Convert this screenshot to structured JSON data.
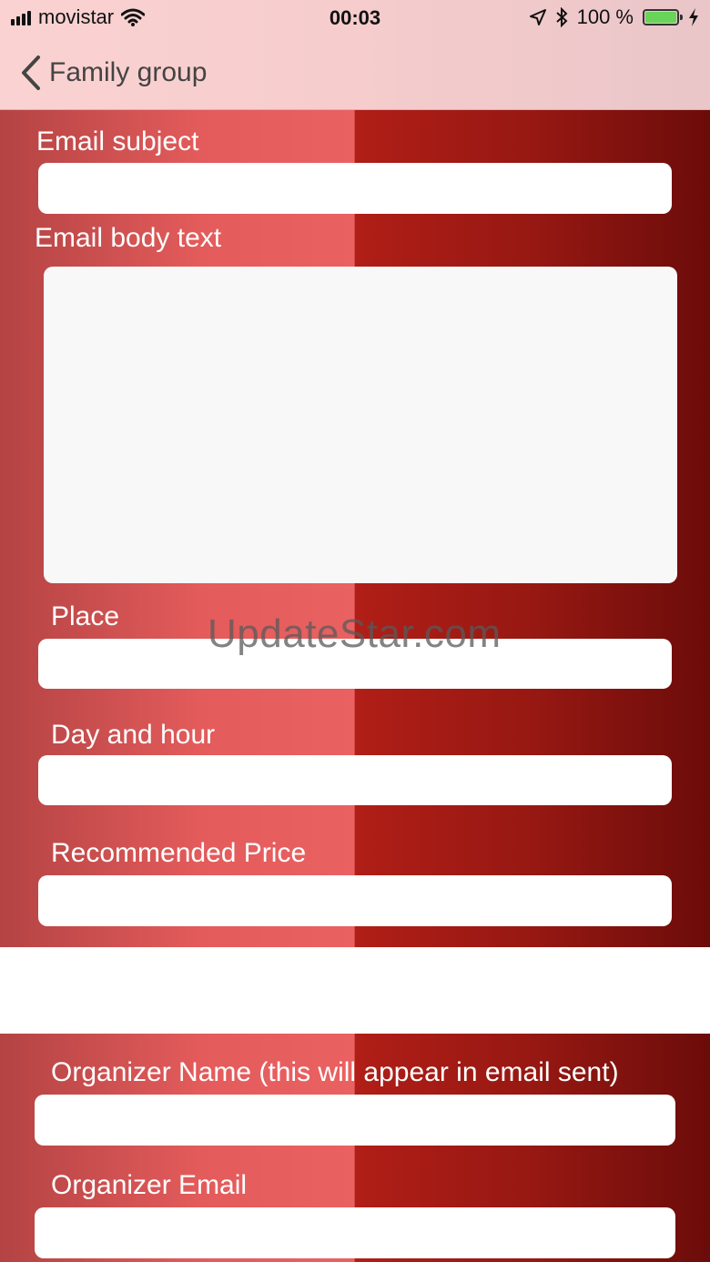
{
  "status_bar": {
    "carrier": "movistar",
    "time": "00:03",
    "battery": "100 %",
    "icons": [
      "signal-bars-icon",
      "wifi-icon",
      "location-arrow-icon",
      "bluetooth-icon",
      "battery-icon",
      "charging-bolt-icon"
    ]
  },
  "nav": {
    "back_label": "Family group",
    "back_icon": "chevron-left-icon"
  },
  "form": {
    "email_subject": {
      "label": "Email subject",
      "value": ""
    },
    "email_body": {
      "label": "Email body text",
      "value": ""
    },
    "place": {
      "label": "Place",
      "value": ""
    },
    "day_hour": {
      "label": "Day and hour",
      "value": ""
    },
    "recommended_price": {
      "label": "Recommended Price",
      "value": ""
    },
    "organizer_name": {
      "label": "Organizer Name (this will appear in email sent)",
      "value": ""
    },
    "organizer_email": {
      "label": "Organizer Email",
      "value": ""
    }
  },
  "watermark": "UpdateStar.com",
  "colors": {
    "top_bar": "#f6cccc",
    "panel_light": "#ea6161",
    "panel_dark": "#6b0c0a",
    "field": "#ffffff",
    "battery_fill": "#69d45a"
  }
}
